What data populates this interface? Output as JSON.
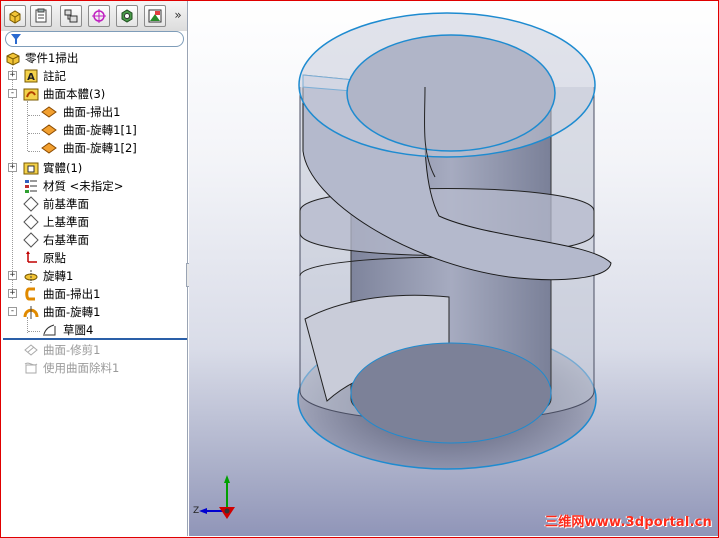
{
  "feature_manager": {
    "tabs": [
      {
        "name": "feature-manager-tab",
        "icon": "feature-tree-icon"
      },
      {
        "name": "property-manager-tab",
        "icon": "property-icon"
      },
      {
        "name": "configuration-manager-tab",
        "icon": "configuration-icon"
      },
      {
        "name": "dimxpert-tab",
        "icon": "target-icon"
      },
      {
        "name": "display-manager-tab",
        "icon": "display-icon"
      },
      {
        "name": "appearance-tab",
        "icon": "appearance-icon"
      }
    ],
    "more_label": "»",
    "filter_icon": "filter-icon",
    "tree": [
      {
        "label": "零件1掃出",
        "icon": "part-icon",
        "expander": "",
        "dim": false
      },
      {
        "label": "註記",
        "icon": "annotation-icon",
        "expander": "+",
        "dim": false
      },
      {
        "label": "曲面本體(3)",
        "icon": "surface-bodies-icon",
        "expander": "-",
        "dim": false
      },
      {
        "label": "曲面-掃出1",
        "icon": "surface-body-icon",
        "expander": "",
        "dim": false
      },
      {
        "label": "曲面-旋轉1[1]",
        "icon": "surface-body-icon",
        "expander": "",
        "dim": false
      },
      {
        "label": "曲面-旋轉1[2]",
        "icon": "surface-body-icon",
        "expander": "",
        "dim": false
      },
      {
        "label": "實體(1)",
        "icon": "solid-bodies-icon",
        "expander": "+",
        "dim": false
      },
      {
        "label": "材質 <未指定>",
        "icon": "material-icon",
        "expander": "",
        "dim": false
      },
      {
        "label": "前基準面",
        "icon": "plane-icon",
        "expander": "",
        "dim": false
      },
      {
        "label": "上基準面",
        "icon": "plane-icon",
        "expander": "",
        "dim": false
      },
      {
        "label": "右基準面",
        "icon": "plane-icon",
        "expander": "",
        "dim": false
      },
      {
        "label": "原點",
        "icon": "origin-icon",
        "expander": "",
        "dim": false
      },
      {
        "label": "旋轉1",
        "icon": "revolve-icon",
        "expander": "+",
        "dim": false
      },
      {
        "label": "曲面-掃出1",
        "icon": "surface-sweep-icon",
        "expander": "+",
        "dim": false
      },
      {
        "label": "曲面-旋轉1",
        "icon": "surface-revolve-icon",
        "expander": "-",
        "dim": false
      },
      {
        "label": "草圖4",
        "icon": "sketch-icon",
        "expander": "",
        "dim": false
      },
      {
        "label": "曲面-修剪1",
        "icon": "surface-trim-icon",
        "expander": "",
        "dim": true
      },
      {
        "label": "使用曲面除料1",
        "icon": "surface-cut-icon",
        "expander": "",
        "dim": true
      }
    ]
  },
  "viewport": {
    "triad": {
      "z_label": "Z",
      "axis_colors": {
        "x": "#d00000",
        "y": "#00a000",
        "z": "#0000d0"
      }
    },
    "watermark": "三维网www.3dportal.cn"
  },
  "colors": {
    "model_face": "#b8bdcf",
    "model_edge": "#1e8bd0",
    "rollback_bar": "#2a5fa8",
    "watermark": "#ff2a1a",
    "frame_border": "#e00000"
  }
}
